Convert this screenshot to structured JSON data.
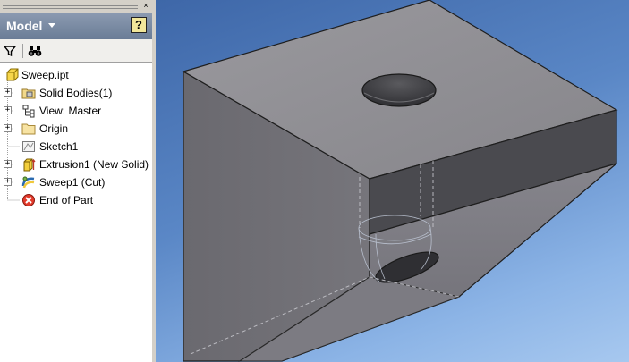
{
  "panel": {
    "title": "Model",
    "help_label": "?"
  },
  "browser": {
    "items": [
      {
        "label": "Sweep.ipt",
        "icon": "part-icon"
      },
      {
        "label": "Solid Bodies(1)",
        "icon": "solid-bodies-folder-icon"
      },
      {
        "label": "View: Master",
        "icon": "view-rep-icon"
      },
      {
        "label": "Origin",
        "icon": "folder-icon"
      },
      {
        "label": "Sketch1",
        "icon": "sketch-icon"
      },
      {
        "label": "Extrusion1 (New Solid)",
        "icon": "extrusion-icon"
      },
      {
        "label": "Sweep1 (Cut)",
        "icon": "sweep-icon"
      },
      {
        "label": "End of Part",
        "icon": "end-of-part-icon"
      }
    ]
  },
  "colors": {
    "header": "#7a8aa4",
    "viewport_top": "#3e67a8",
    "viewport_bottom": "#a7c8ef",
    "part_face_top": "#8f8e93",
    "end_of_part": "#e23a2b"
  }
}
